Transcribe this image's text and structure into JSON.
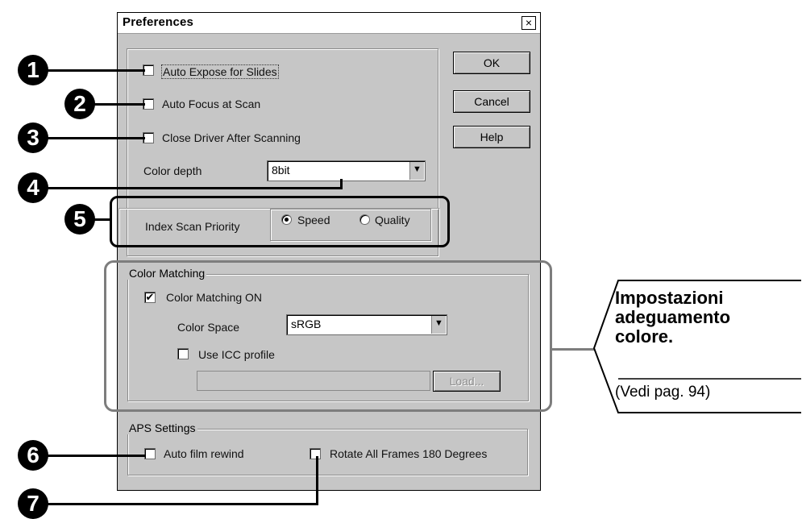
{
  "dialog": {
    "title": "Preferences",
    "close_glyph": "×",
    "buttons": {
      "ok": "OK",
      "cancel": "Cancel",
      "help": "Help"
    },
    "options": {
      "auto_expose": {
        "label": "Auto Expose for Slides",
        "checked": false
      },
      "auto_focus": {
        "label": "Auto Focus at Scan",
        "checked": false
      },
      "close_driver": {
        "label": "Close Driver After Scanning",
        "checked": false
      }
    },
    "color_depth": {
      "label": "Color depth",
      "value": "8bit"
    },
    "index_scan": {
      "label": "Index Scan Priority",
      "options": [
        "Speed",
        "Quality"
      ],
      "selected": "Speed"
    },
    "color_matching": {
      "group_title": "Color Matching",
      "enabled_label": "Color Matching ON",
      "enabled": true,
      "color_space_label": "Color Space",
      "color_space_value": "sRGB",
      "use_icc_label": "Use ICC profile",
      "use_icc": false,
      "profile_path": "",
      "load_button": "Load..."
    },
    "aps": {
      "group_title": "APS Settings",
      "auto_rewind_label": "Auto film rewind",
      "rotate_label": "Rotate All Frames 180 Degrees"
    }
  },
  "markers": [
    "1",
    "2",
    "3",
    "4",
    "5",
    "6",
    "7"
  ],
  "callout": {
    "line1": "Impostazioni",
    "line2": "adeguamento",
    "line3": "colore.",
    "ref": "(Vedi pag. 94)"
  },
  "colors": {
    "dialog_face": "#c6c6c6",
    "highlight_outline": "#7d7d7d",
    "marker": "#000000"
  }
}
